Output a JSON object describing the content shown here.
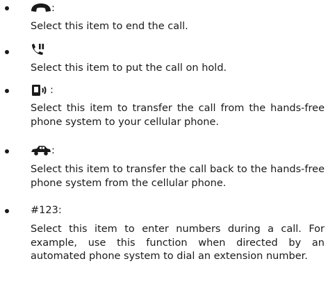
{
  "items": [
    {
      "icon": "end-call-handset-icon",
      "suffix": ":",
      "description": "Select this item to end the call."
    },
    {
      "icon": "hold-call-icon",
      "suffix": "",
      "description": "Select this item to put the call on hold."
    },
    {
      "icon": "cellular-phone-icon",
      "suffix": ":",
      "description": "Select this item to transfer the call from the hands-free phone system to your cellular phone."
    },
    {
      "icon": "car-icon",
      "suffix": ":",
      "description": "Select this item to transfer the call back to the hands-free phone system from the cellular phone."
    },
    {
      "label": "#123",
      "suffix": ":",
      "description": "Select this item to enter numbers during a call. For example, use this function when directed by an automated phone system to dial an extension number."
    }
  ]
}
